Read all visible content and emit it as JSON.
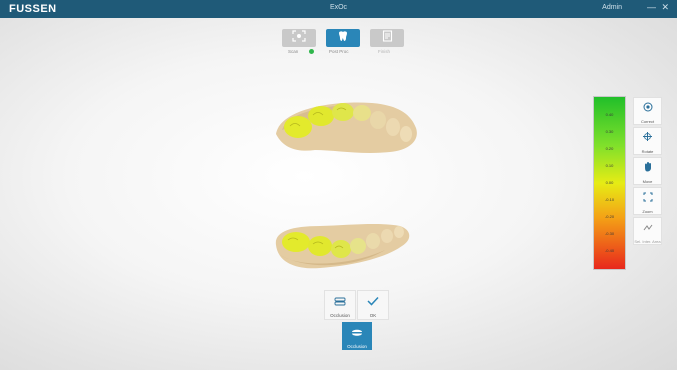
{
  "titlebar": {
    "brand": "FUSSEN",
    "title": "ExOc",
    "user": "Admin",
    "minimize": "—",
    "close": "✕"
  },
  "toolbar": {
    "tools": [
      {
        "label": "Scan",
        "icon": "scan-icon",
        "state": "inactive",
        "status_dot": "green"
      },
      {
        "label": "Post Proc",
        "icon": "tooth-icon",
        "state": "active"
      },
      {
        "label": "Finish",
        "icon": "document-icon",
        "state": "inactive"
      }
    ]
  },
  "legend": {
    "ticks": [
      "0.40",
      "0.30",
      "0.20",
      "0.10",
      "0.00",
      "-0.10",
      "-0.20",
      "-0.30",
      "-0.40"
    ],
    "colors": {
      "top": "#21bf2a",
      "mid": "#e6ec15",
      "bottom": "#e8281c"
    }
  },
  "side_buttons": [
    {
      "label": "Correct",
      "icon": "target-icon",
      "enabled": true
    },
    {
      "label": "Rotate",
      "icon": "rotate-icon",
      "enabled": true
    },
    {
      "label": "Move",
      "icon": "hand-icon",
      "enabled": true
    },
    {
      "label": "Zoom",
      "icon": "zoom-icon",
      "enabled": true
    },
    {
      "label": "Sel. Inter. Area",
      "icon": "select-area-icon",
      "enabled": false
    }
  ],
  "bottom_buttons": [
    {
      "label": "Occlusion",
      "icon": "occlusion-icon"
    },
    {
      "label": "OK",
      "icon": "check-icon"
    }
  ],
  "main_button": {
    "label": "Occlusion",
    "icon": "jaw-icon"
  },
  "colors": {
    "accent": "#2a86b8",
    "titlebar": "#1f5a78",
    "gum": "#e6cfa6",
    "contact": "#e6ee2a"
  }
}
